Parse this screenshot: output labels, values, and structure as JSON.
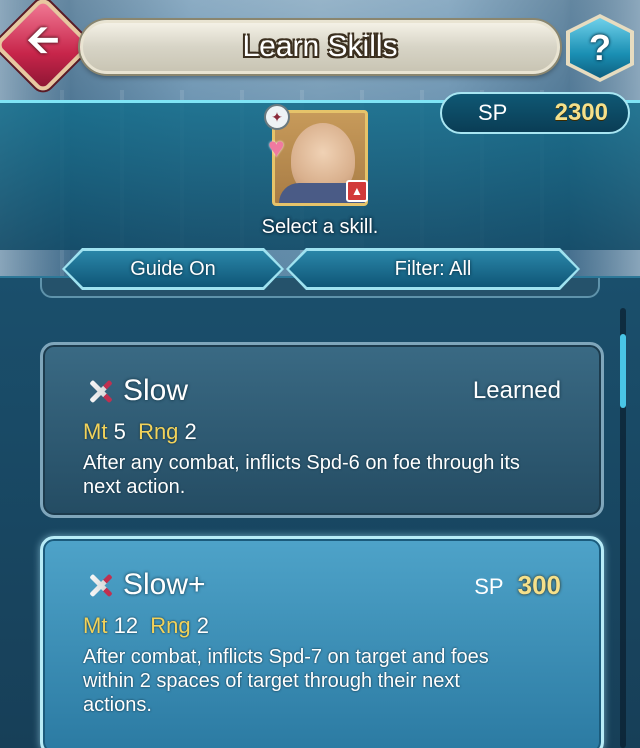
{
  "header": {
    "title": "Learn Skills",
    "back_icon": "left-arrow-icon",
    "help_label": "?"
  },
  "sp": {
    "label": "SP",
    "value": "2300"
  },
  "hint": "Select a skill.",
  "toolbar": {
    "guide_label": "Guide On",
    "filter_label": "Filter: All"
  },
  "skills": [
    {
      "name": "Slow",
      "status": "Learned",
      "mt_label": "Mt",
      "mt": "5",
      "rng_label": "Rng",
      "rng": "2",
      "description": "After any combat, inflicts Spd-6 on foe through its next action."
    },
    {
      "name": "Slow+",
      "cost_label": "SP",
      "cost": "300",
      "mt_label": "Mt",
      "mt": "12",
      "rng_label": "Rng",
      "rng": "2",
      "description": "After combat, inflicts Spd-7 on target and foes within 2 spaces of target through their next actions."
    }
  ],
  "colors": {
    "accent": "#7fe4f5",
    "gold": "#f5e08a",
    "stat_key": "#f2d25a",
    "back_button": "#c7254a"
  }
}
